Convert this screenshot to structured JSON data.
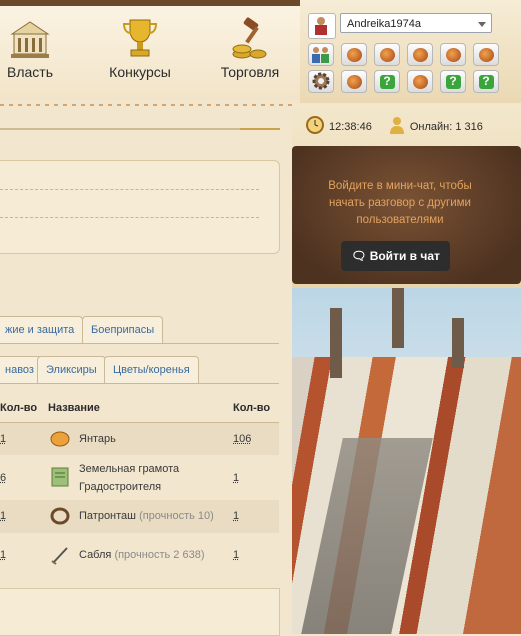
{
  "nav": {
    "items": [
      {
        "label": "Власть",
        "icon": "government-building-icon"
      },
      {
        "label": "Конкурсы",
        "icon": "trophy-icon"
      },
      {
        "label": "Торговля",
        "icon": "gavel-coins-icon"
      }
    ]
  },
  "tabs_row1": [
    "жие и защита",
    "Боеприпасы"
  ],
  "tabs_row2": [
    "навоз",
    "Эликсиры",
    "Цветы/коренья"
  ],
  "table": {
    "headers": {
      "qty_left": "Кол-во",
      "name": "Название",
      "qty": "Кол-во"
    },
    "rows": [
      {
        "qty_left": "1",
        "icon": "amber-icon",
        "name": "Янтарь",
        "note": "",
        "qty": "106"
      },
      {
        "qty_left": "6",
        "icon": "land-deed-icon",
        "name": "Земельная грамота",
        "name2": "Градостроителя",
        "note": "",
        "qty": "1"
      },
      {
        "qty_left": "1",
        "icon": "bandolier-icon",
        "name": "Патронташ",
        "note": "(прочность 10)",
        "qty": "1"
      },
      {
        "qty_left": "1",
        "icon": "saber-icon",
        "name": "Сабля",
        "note": "(прочность 2 638)",
        "qty": "1"
      }
    ]
  },
  "user": {
    "name": "Andreika1974a"
  },
  "quick_icons": [
    "coin-icon",
    "coin-icon",
    "coin-icon",
    "coin-icon",
    "coin-icon",
    "gear-icon",
    "question-icon",
    "coin-icon",
    "question-icon",
    "question-icon"
  ],
  "status": {
    "time": "12:38:46",
    "online_label": "Онлайн: 1 316"
  },
  "chat": {
    "prompt": "Войдите в мини-чат, чтобы начать разговор с другими пользователями",
    "button": "Войти в чат"
  },
  "colors": {
    "link": "#3a6a9b",
    "chat_text": "#e3a35e",
    "chat_button": "#2d2d2d"
  }
}
